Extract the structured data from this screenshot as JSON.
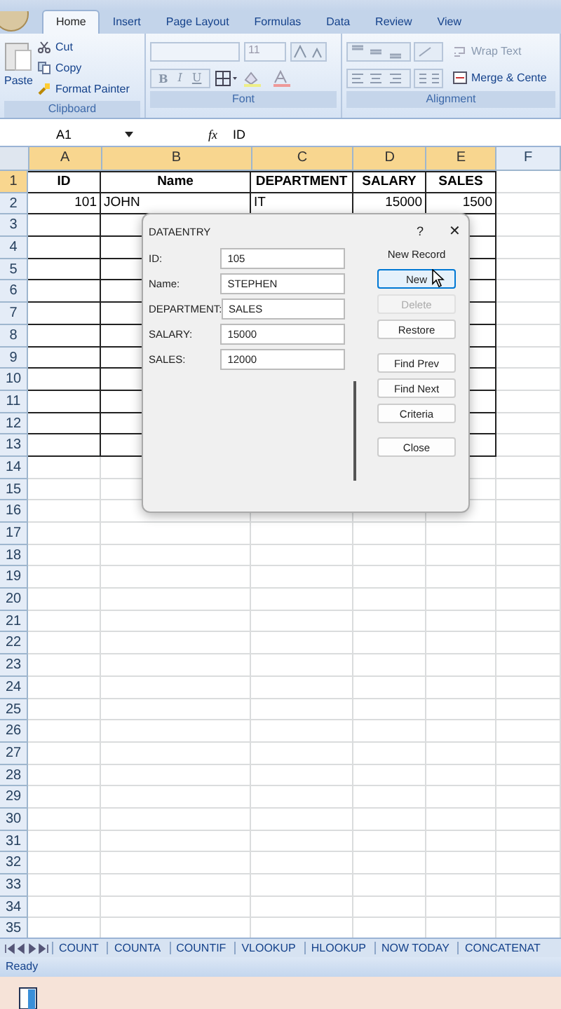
{
  "ribbon_tabs": [
    {
      "label": "Home",
      "selected": true
    },
    {
      "label": "Insert",
      "selected": false
    },
    {
      "label": "Page Layout",
      "selected": false
    },
    {
      "label": "Formulas",
      "selected": false
    },
    {
      "label": "Data",
      "selected": false
    },
    {
      "label": "Review",
      "selected": false
    },
    {
      "label": "View",
      "selected": false
    }
  ],
  "clipboard": {
    "paste": "Paste",
    "cut": "Cut",
    "copy": "Copy",
    "format_painter": "Format Painter",
    "label": "Clipboard"
  },
  "font": {
    "size": "11",
    "bold": "B",
    "italic": "I",
    "underline": "U",
    "label": "Font"
  },
  "alignment": {
    "wrap_text": "Wrap Text",
    "merge": "Merge & Cente",
    "label": "Alignment"
  },
  "formula_bar": {
    "name_box": "A1",
    "fx": "fx",
    "value": "ID"
  },
  "columns": [
    {
      "label": "A",
      "selected": true
    },
    {
      "label": "B",
      "selected": true
    },
    {
      "label": "C",
      "selected": true
    },
    {
      "label": "D",
      "selected": true
    },
    {
      "label": "E",
      "selected": true
    },
    {
      "label": "F",
      "selected": false
    }
  ],
  "rows": [
    {
      "number": "1",
      "selected": true,
      "cells": [
        "ID",
        "Name",
        "DEPARTMENT",
        "SALARY",
        "SALES"
      ]
    },
    {
      "number": "2",
      "selected": false,
      "cells": [
        "101",
        "JOHN",
        "IT",
        "15000",
        "1500"
      ]
    },
    {
      "number": "3",
      "selected": false
    },
    {
      "number": "4",
      "selected": false
    },
    {
      "number": "5",
      "selected": false
    },
    {
      "number": "6",
      "selected": false
    },
    {
      "number": "7",
      "selected": false
    },
    {
      "number": "8",
      "selected": false
    },
    {
      "number": "9",
      "selected": false
    },
    {
      "number": "10",
      "selected": false
    },
    {
      "number": "11",
      "selected": false
    },
    {
      "number": "12",
      "selected": false
    },
    {
      "number": "13",
      "selected": false
    },
    {
      "number": "14",
      "selected": false
    },
    {
      "number": "15",
      "selected": false
    },
    {
      "number": "16",
      "selected": false
    },
    {
      "number": "17",
      "selected": false
    },
    {
      "number": "18",
      "selected": false
    },
    {
      "number": "19",
      "selected": false
    },
    {
      "number": "20",
      "selected": false
    },
    {
      "number": "21",
      "selected": false
    },
    {
      "number": "22",
      "selected": false
    },
    {
      "number": "23",
      "selected": false
    },
    {
      "number": "24",
      "selected": false
    },
    {
      "number": "25",
      "selected": false
    },
    {
      "number": "26",
      "selected": false
    },
    {
      "number": "27",
      "selected": false
    },
    {
      "number": "28",
      "selected": false
    },
    {
      "number": "29",
      "selected": false
    },
    {
      "number": "30",
      "selected": false
    },
    {
      "number": "31",
      "selected": false
    },
    {
      "number": "32",
      "selected": false
    },
    {
      "number": "33",
      "selected": false
    },
    {
      "number": "34",
      "selected": false
    },
    {
      "number": "35",
      "selected": false
    }
  ],
  "dialog": {
    "title": "DATAENTRY",
    "help": "?",
    "close": "✕",
    "record_label": "New Record",
    "fields": [
      {
        "label": "ID:",
        "value": "105"
      },
      {
        "label": "Name:",
        "value": "STEPHEN"
      },
      {
        "label": "DEPARTMENT:",
        "value": "SALES"
      },
      {
        "label": "SALARY:",
        "value": "15000"
      },
      {
        "label": "SALES:",
        "value": "12000"
      }
    ],
    "buttons": [
      {
        "label": "New",
        "focused": true,
        "disabled": false
      },
      {
        "label": "Delete",
        "focused": false,
        "disabled": true
      },
      {
        "label": "Restore",
        "focused": false,
        "disabled": false
      },
      {
        "label": "Find Prev",
        "focused": false,
        "disabled": false
      },
      {
        "label": "Find Next",
        "focused": false,
        "disabled": false
      },
      {
        "label": "Criteria",
        "focused": false,
        "disabled": false
      },
      {
        "label": "Close",
        "focused": false,
        "disabled": false
      }
    ]
  },
  "sheet_tabs": [
    "COUNT",
    "COUNTA",
    "COUNTIF",
    "VLOOKUP",
    "HLOOKUP",
    "NOW TODAY",
    "CONCATENAT"
  ],
  "status_bar": {
    "text": "Ready"
  }
}
